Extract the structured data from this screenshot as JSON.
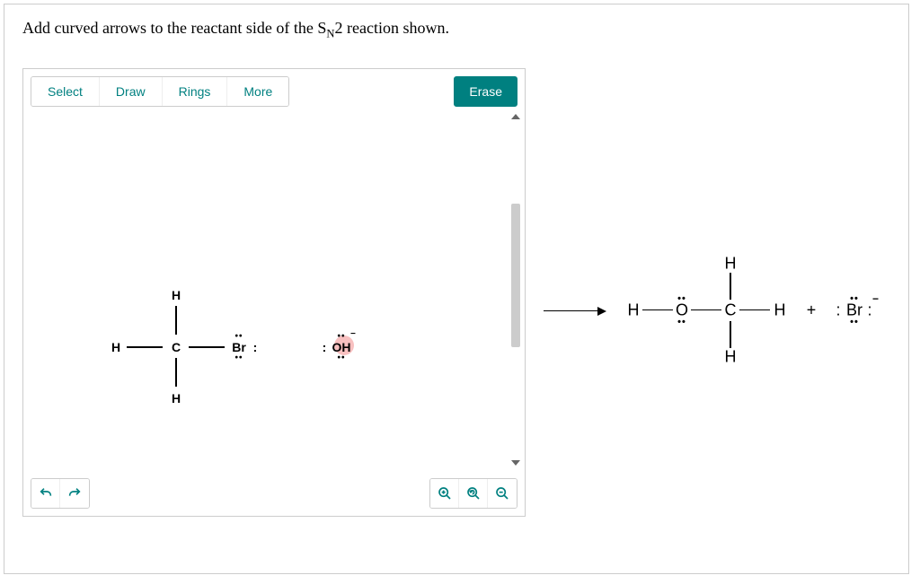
{
  "question": {
    "prefix": "Add curved arrows to the reactant side of the S",
    "subscript": "N",
    "suffix": "2 reaction shown."
  },
  "toolbar": {
    "select": "Select",
    "draw": "Draw",
    "rings": "Rings",
    "more": "More",
    "erase": "Erase"
  },
  "reactant": {
    "H_top": "H",
    "H_left": "H",
    "H_bottom": "H",
    "C": "C",
    "Br": "Br",
    "OH": "OH"
  },
  "product": {
    "H_left": "H",
    "O": "O",
    "C": "C",
    "H_top": "H",
    "H_right": "H",
    "H_bottom": "H",
    "plus": "+",
    "Br": "Br"
  },
  "icons": {
    "undo": "↶",
    "redo": "↷",
    "zoom_in_glyph": "⊕",
    "zoom_reset_glyph": "↻",
    "zoom_out_glyph": "⊖"
  },
  "chart_data": null
}
